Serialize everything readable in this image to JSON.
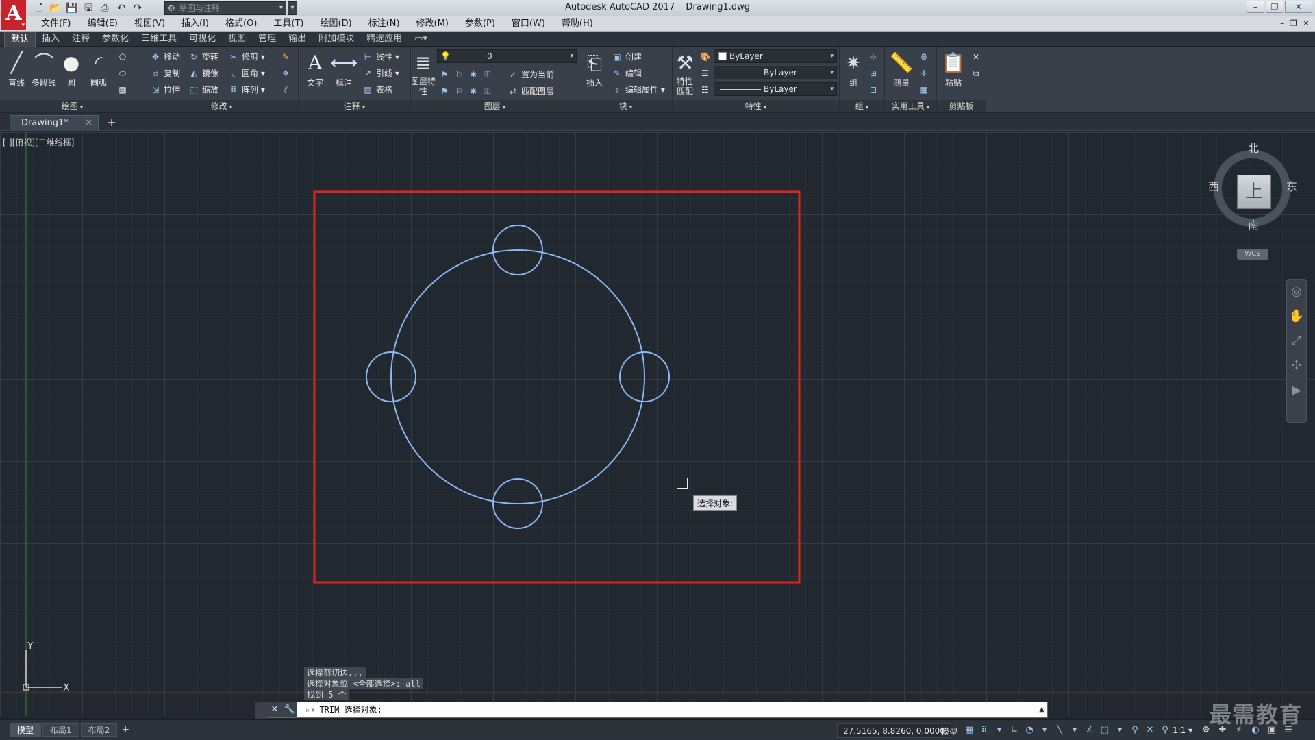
{
  "titlebar": {
    "app_name": "Autodesk AutoCAD 2017",
    "file_name": "Drawing1.dwg",
    "workspace": "草图与注释",
    "logo": "A"
  },
  "menu": {
    "items": [
      "文件(F)",
      "编辑(E)",
      "视图(V)",
      "插入(I)",
      "格式(O)",
      "工具(T)",
      "绘图(D)",
      "标注(N)",
      "修改(M)",
      "参数(P)",
      "窗口(W)",
      "帮助(H)"
    ]
  },
  "ribbon_tabs": {
    "items": [
      "默认",
      "插入",
      "注释",
      "参数化",
      "三维工具",
      "可视化",
      "视图",
      "管理",
      "输出",
      "附加模块",
      "精选应用"
    ],
    "active": "默认",
    "extra": "▭▾"
  },
  "ribbon": {
    "draw": {
      "title": "绘图",
      "line": "直线",
      "polyline": "多段线",
      "circle": "圆",
      "arc": "圆弧"
    },
    "modify": {
      "title": "修改",
      "move": "移动",
      "rotate": "旋转",
      "trim": "修剪",
      "copy": "复制",
      "mirror": "镜像",
      "fillet": "圆角",
      "stretch": "拉伸",
      "scale": "缩放",
      "array": "阵列"
    },
    "annotation": {
      "title": "注释",
      "text": "文字",
      "dimension": "标注",
      "linear": "线性",
      "leader": "引线",
      "table": "表格"
    },
    "layers": {
      "title": "图层",
      "layer_properties": "图层特性",
      "current_layer": "0",
      "set_current": "置为当前",
      "match_layer": "匹配图层"
    },
    "block": {
      "title": "块",
      "insert": "插入",
      "create": "创建",
      "edit": "编辑",
      "edit_attributes": "编辑属性"
    },
    "properties": {
      "title": "特性",
      "match": "特性匹配",
      "color": "ByLayer",
      "linetype": "ByLayer",
      "lineweight": "ByLayer"
    },
    "groups": {
      "title": "组",
      "group": "组"
    },
    "utilities": {
      "title": "实用工具",
      "measure": "测量"
    },
    "clipboard": {
      "title": "剪贴板",
      "paste": "粘贴"
    }
  },
  "file_tabs": {
    "drawing": "Drawing1*",
    "add": "+"
  },
  "viewport": {
    "label": "[-][俯视][二维线框]"
  },
  "viewcube": {
    "north": "北",
    "south": "南",
    "east": "东",
    "west": "西",
    "face": "上",
    "wcs": "WCS"
  },
  "ucs": {
    "x": "X",
    "y": "Y"
  },
  "command": {
    "history": [
      "选择剪切边...",
      "选择对象或 <全部选择>:  all",
      "找到 5 个"
    ],
    "prompt": "TRIM 选择对象:",
    "tooltip": "选择对象:"
  },
  "status": {
    "layouts": [
      "模型",
      "布局1",
      "布局2"
    ],
    "active_layout": "模型",
    "coords": "27.5165, 8.8260, 0.0000",
    "model": "模型",
    "scale": "1:1"
  },
  "watermark": "最需教育",
  "colors": {
    "selection_frame": "#e0231f",
    "geometry": "#8fb6f5",
    "background": "#212830",
    "logo": "#c8232c"
  }
}
